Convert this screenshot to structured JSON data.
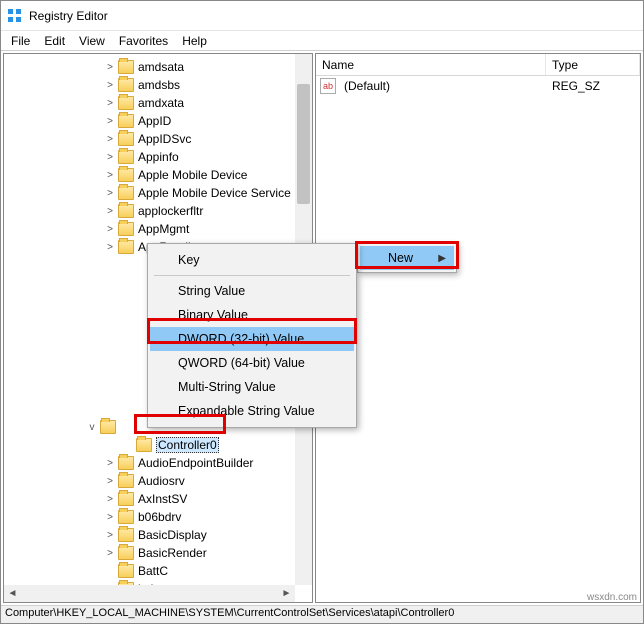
{
  "app": {
    "title": "Registry Editor"
  },
  "menu": {
    "file": "File",
    "edit": "Edit",
    "view": "View",
    "favorites": "Favorites",
    "help": "Help"
  },
  "tree": {
    "indent_base": 100,
    "items": [
      {
        "label": "amdsata",
        "exp": ">"
      },
      {
        "label": "amdsbs",
        "exp": ">"
      },
      {
        "label": "amdxata",
        "exp": ">"
      },
      {
        "label": "AppID",
        "exp": ">"
      },
      {
        "label": "AppIDSvc",
        "exp": ">"
      },
      {
        "label": "Appinfo",
        "exp": ">"
      },
      {
        "label": "Apple Mobile Device",
        "exp": ">"
      },
      {
        "label": "Apple Mobile Device Service",
        "exp": ">"
      },
      {
        "label": "applockerfltr",
        "exp": ">"
      },
      {
        "label": "AppMgmt",
        "exp": ">"
      },
      {
        "label": "AppReadiness",
        "exp": ">"
      }
    ],
    "selected": {
      "label": "Controller0",
      "exp": ""
    },
    "parent_exp": "v",
    "after": [
      {
        "label": "AudioEndpointBuilder",
        "exp": ">"
      },
      {
        "label": "Audiosrv",
        "exp": ">"
      },
      {
        "label": "AxInstSV",
        "exp": ">"
      },
      {
        "label": "b06bdrv",
        "exp": ">"
      },
      {
        "label": "BasicDisplay",
        "exp": ">"
      },
      {
        "label": "BasicRender",
        "exp": ">"
      },
      {
        "label": "BattC",
        "exp": ""
      },
      {
        "label": "bcbtums",
        "exp": ">"
      }
    ]
  },
  "list": {
    "col_name": "Name",
    "col_type": "Type",
    "rows": [
      {
        "icon": "ab",
        "name": "(Default)",
        "type": "REG_SZ"
      }
    ]
  },
  "ctx_parent": {
    "new": "New"
  },
  "ctx_new": {
    "key": "Key",
    "string": "String Value",
    "binary": "Binary Value",
    "dword": "DWORD (32-bit) Value",
    "qword": "QWORD (64-bit) Value",
    "multi": "Multi-String Value",
    "expand": "Expandable String Value"
  },
  "status": {
    "path": "Computer\\HKEY_LOCAL_MACHINE\\SYSTEM\\CurrentControlSet\\Services\\atapi\\Controller0"
  },
  "watermark": "wsxdn.com"
}
